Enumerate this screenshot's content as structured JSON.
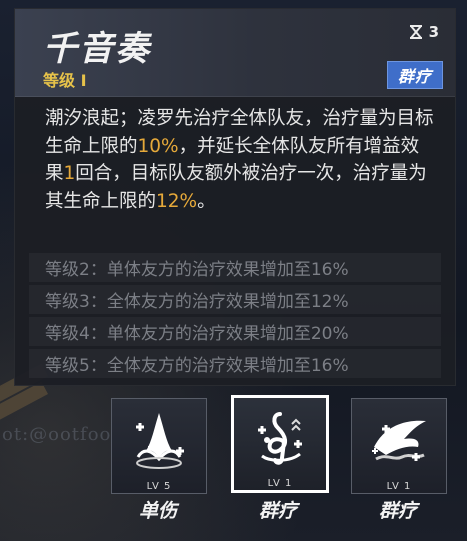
{
  "skill": {
    "title": "千音奏",
    "level_label": "等级 Ⅰ",
    "cost": "3",
    "cost_icon": "hourglass-icon",
    "tag": "群疗"
  },
  "description": {
    "p1": "潮汐浪起；凌罗先治疗全体队友，治疗量为目标生命上限的",
    "v1": "10%",
    "p2": "，并延长全体队友所有增益效果",
    "v2": "1",
    "p3": "回合，目标队友额外被治疗一次，治疗量为其生命上限的",
    "v3": "12%",
    "p4": "。"
  },
  "levels": [
    "等级2：单体友方的治疗效果增加至16%",
    "等级3：全体友方的治疗效果增加至12%",
    "等级4：单体友方的治疗效果增加至20%",
    "等级5：全体友方的治疗效果增加至16%"
  ],
  "cards": [
    {
      "lv": "LV 5",
      "label": "单伤",
      "icon": "splash-heal-icon"
    },
    {
      "lv": "LV 1",
      "label": "群疗",
      "icon": "music-note-heal-icon"
    },
    {
      "lv": "LV 1",
      "label": "群疗",
      "icon": "wave-heal-icon"
    }
  ],
  "background_text": "ot:@ootfoot",
  "colors": {
    "highlight": "#e6a93a",
    "level": "#e6c24a",
    "tag": "#3f6ec9"
  }
}
